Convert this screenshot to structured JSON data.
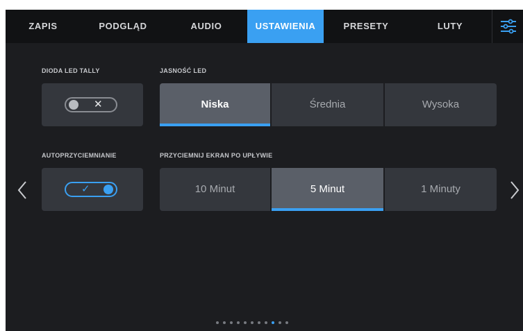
{
  "tabs": [
    {
      "label": "ZAPIS"
    },
    {
      "label": "PODGLĄD"
    },
    {
      "label": "AUDIO"
    },
    {
      "label": "USTAWIENIA"
    },
    {
      "label": "PRESETY"
    },
    {
      "label": "LUTY"
    }
  ],
  "active_tab": "USTAWIENIA",
  "tally": {
    "label": "DIODA LED TALLY",
    "state": "off"
  },
  "led_brightness": {
    "label": "JASNOŚĆ LED",
    "options": [
      "Niska",
      "Średnia",
      "Wysoka"
    ],
    "selected": "Niska"
  },
  "auto_dim": {
    "label": "AUTOPRZYCIEMNIANIE",
    "state": "on"
  },
  "dim_after": {
    "label": "PRZYCIEMNIJ EKRAN PO UPŁYWIE",
    "options": [
      "10 Minut",
      "5 Minut",
      "1 Minuty"
    ],
    "selected": "5 Minut"
  },
  "pagination": {
    "total": 11,
    "current": 9
  },
  "colors": {
    "accent": "#3aa0f2",
    "background": "#1c1d20",
    "card": "#34373d",
    "selected": "#5a5f68"
  },
  "icons": {
    "settings": "sliders-icon",
    "prev": "chevron-left-icon",
    "next": "chevron-right-icon",
    "off": "x-icon",
    "on": "check-icon"
  }
}
